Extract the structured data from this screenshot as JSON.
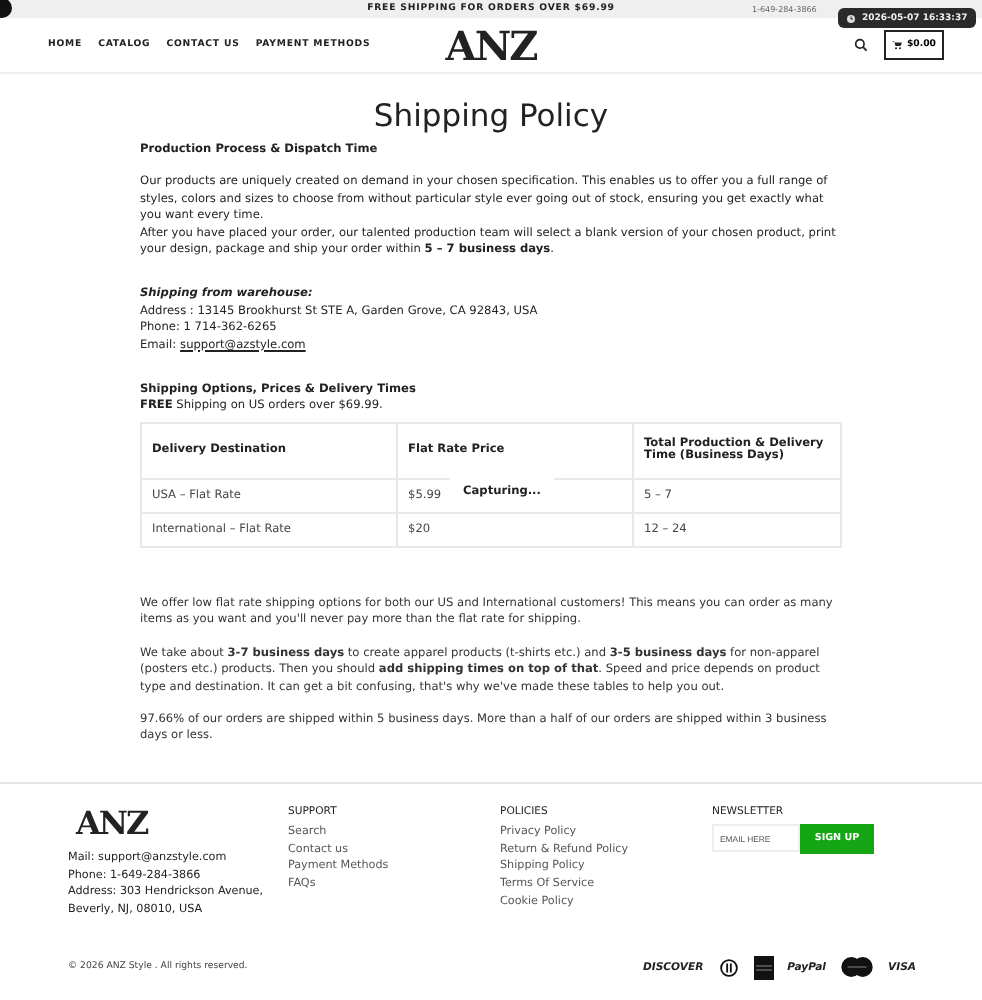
{
  "announcement": {
    "text": "FREE SHIPPING FOR ORDERS OVER $69.99",
    "phone": "1-649-284-3866"
  },
  "timestamp_badge": "2026-05-07 16:33:37",
  "nav": {
    "links": [
      "HOME",
      "CATALOG",
      "CONTACT US",
      "PAYMENT METHODS"
    ],
    "logo": "ANZ",
    "cart": "$0.00"
  },
  "page_title": "Shipping Policy",
  "section_1": {
    "heading": "Production Process & Dispatch Time",
    "paragraphs": [
      "Our products are uniquely created on demand in your chosen specification. This enables us to offer you a full range of styles, colors and sizes to choose from without particular style ever going out of stock, ensuring you get exactly what you want every time.",
      "After you have placed your order, our talented production team will select a blank version of your chosen product, print your design, package and ship your order within **5 – 7 business days**."
    ]
  },
  "warehouse": {
    "heading": "Shipping from warehouse:",
    "address": "Address : 13145 Brookhurst St STE A, Garden Grove, CA 92843, USA",
    "phone": "Phone: 1 714-362-6265",
    "email_label": "Email:",
    "email": "support@azstyle.com"
  },
  "section_2": {
    "heading": "Shipping Options, Prices & Delivery Times",
    "note": "**FREE** Shipping on US orders over $69.99."
  },
  "table": {
    "columns": [
      "Delivery Destination",
      "Flat Rate Price",
      "Total Production & Delivery Time (Business Days)"
    ],
    "rows": [
      [
        "USA – Flat Rate",
        "$5.99",
        "5 – 7"
      ],
      [
        "International – Flat Rate",
        "$20",
        "12 – 24"
      ]
    ]
  },
  "capturing_label": "Capturing...",
  "paragraphs": [
    "We offer low flat rate shipping options for both our US and International customers! This means you can order as many items as you want and you'll never pay more than the flat rate for shipping.",
    "We take about **3-7 business days** to create apparel products (t-shirts etc.) and **3-5 business days** for non-apparel (posters etc.) products. Then you should **add shipping times on top of that**. Speed and price depends on product type and destination. It can get a bit confusing, that's why we've made these tables to help you out.",
    "97.66% of our orders are shipped within 5 business days. More than a half of our orders are shipped within 3 business days or less."
  ],
  "footer": {
    "logo": "ANZ",
    "contact": [
      "Mail: support@anzstyle.com",
      "Phone: 1-649-284-3866",
      "Address: 303 Hendrickson Avenue, Beverly, NJ, 08010, USA"
    ],
    "support": {
      "title": "SUPPORT",
      "links": [
        "Search",
        "Contact us",
        "Payment Methods",
        "FAQs"
      ]
    },
    "policies": {
      "title": "POLICIES",
      "links": [
        "Privacy Policy",
        "Return & Refund Policy",
        "Shipping Policy",
        "Terms Of Service",
        "Cookie Policy"
      ]
    },
    "newsletter": {
      "title": "NEWSLETTER",
      "placeholder": "EMAIL HERE",
      "button": "SIGN UP"
    },
    "copyright": "© 2026 ANZ Style . All rights reserved.",
    "payments": [
      {
        "kind": "text",
        "label": "DISCOVER"
      },
      {
        "kind": "diners"
      },
      {
        "kind": "amex"
      },
      {
        "kind": "text",
        "label": "PayPal"
      },
      {
        "kind": "mastercard"
      },
      {
        "kind": "text",
        "label": "VISA"
      }
    ]
  }
}
